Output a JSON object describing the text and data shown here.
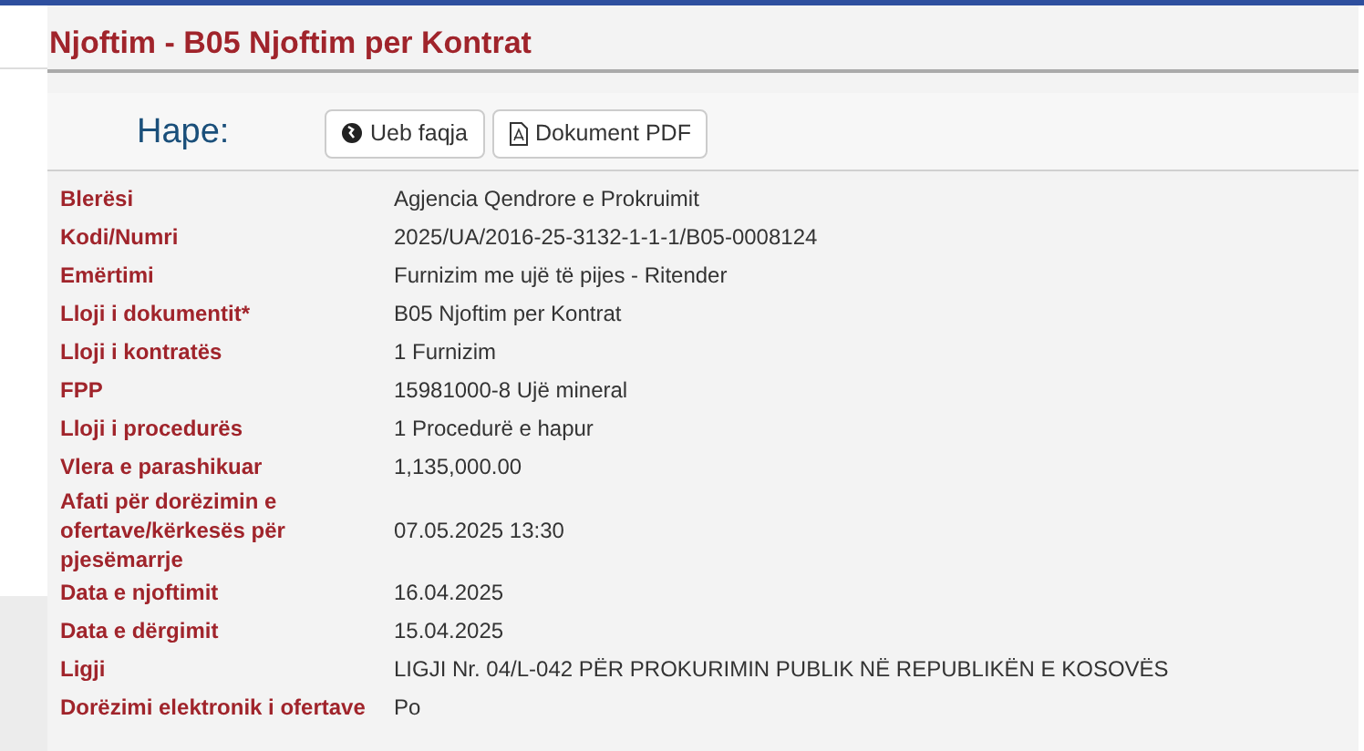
{
  "title": "Njoftim - B05 Njoftim per Kontrat",
  "open_label": "Hape:",
  "buttons": [
    {
      "kind": "web",
      "label": "Ueb faqja"
    },
    {
      "kind": "pdf",
      "label": "Dokument PDF"
    }
  ],
  "fields": [
    {
      "label": "Blerësi",
      "value": "Agjencia Qendrore e Prokruimit"
    },
    {
      "label": "Kodi/Numri",
      "value": "2025/UA/2016-25-3132-1-1-1/B05-0008124"
    },
    {
      "label": "Emërtimi",
      "value": "Furnizim me ujë të pijes - Ritender"
    },
    {
      "label": "Lloji i dokumentit*",
      "value": "B05 Njoftim per Kontrat"
    },
    {
      "label": "Lloji i kontratës",
      "value": "1 Furnizim"
    },
    {
      "label": "FPP",
      "value": "15981000-8 Ujë mineral"
    },
    {
      "label": "Lloji i procedurës",
      "value": "1 Procedurë e hapur"
    },
    {
      "label": "Vlera e parashikuar",
      "value": "1,135,000.00"
    },
    {
      "label": "Afati për dorëzimin e ofertave/kërkesës për pjesëmarrje",
      "value": "07.05.2025 13:30"
    },
    {
      "label": "Data e njoftimit",
      "value": "16.04.2025"
    },
    {
      "label": "Data e dërgimit",
      "value": "15.04.2025"
    },
    {
      "label": "Ligji",
      "value": "LIGJI Nr. 04/L-042 PËR PROKURIMIN PUBLIK NË REPUBLIKËN E KOSOVËS"
    },
    {
      "label": "Dorëzimi elektronik i ofertave",
      "value": "Po"
    }
  ]
}
